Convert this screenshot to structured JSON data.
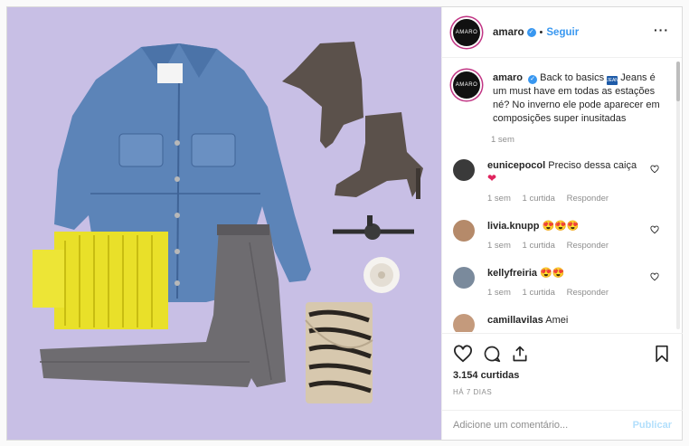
{
  "header": {
    "username": "amaro",
    "avatar_text": "AMARO",
    "separator": "•",
    "follow_label": "Seguir",
    "more_icon": "more-horizontal-icon"
  },
  "caption": {
    "username": "amaro",
    "text_before_emoji": "Back to basics",
    "emoji_text": "JEANS",
    "text_after_emoji": "Jeans é um must have em todas as estações né? No inverno ele pode aparecer em composições super inusitadas",
    "time": "1 sem"
  },
  "comments": [
    {
      "username": "eunicepocol",
      "text": "Preciso dessa caiça",
      "emoji": "❤",
      "time": "1 sem",
      "likes": "1 curtida",
      "reply": "Responder",
      "avatar_color": "#3a3a3a"
    },
    {
      "username": "livia.knupp",
      "text": "",
      "emoji": "😍😍😍",
      "time": "1 sem",
      "likes": "1 curtida",
      "reply": "Responder",
      "avatar_color": "#b58a6a"
    },
    {
      "username": "kellyfreiria",
      "text": "",
      "emoji": "😍😍",
      "time": "1 sem",
      "likes": "1 curtida",
      "reply": "Responder",
      "avatar_color": "#7a8a9c"
    },
    {
      "username": "camillavilas",
      "text": "Amei",
      "emoji": "",
      "time": "",
      "likes": "",
      "reply": "",
      "avatar_color": "#c49a7c"
    }
  ],
  "actions": {
    "likes_count": "3.154 curtidas",
    "date": "HÁ 7 DIAS"
  },
  "add_comment": {
    "placeholder": "Adicione um comentário...",
    "post_label": "Publicar"
  },
  "colors": {
    "accent": "#3897f0",
    "background": "#c9c0e6",
    "muted": "#8e8e8e"
  }
}
